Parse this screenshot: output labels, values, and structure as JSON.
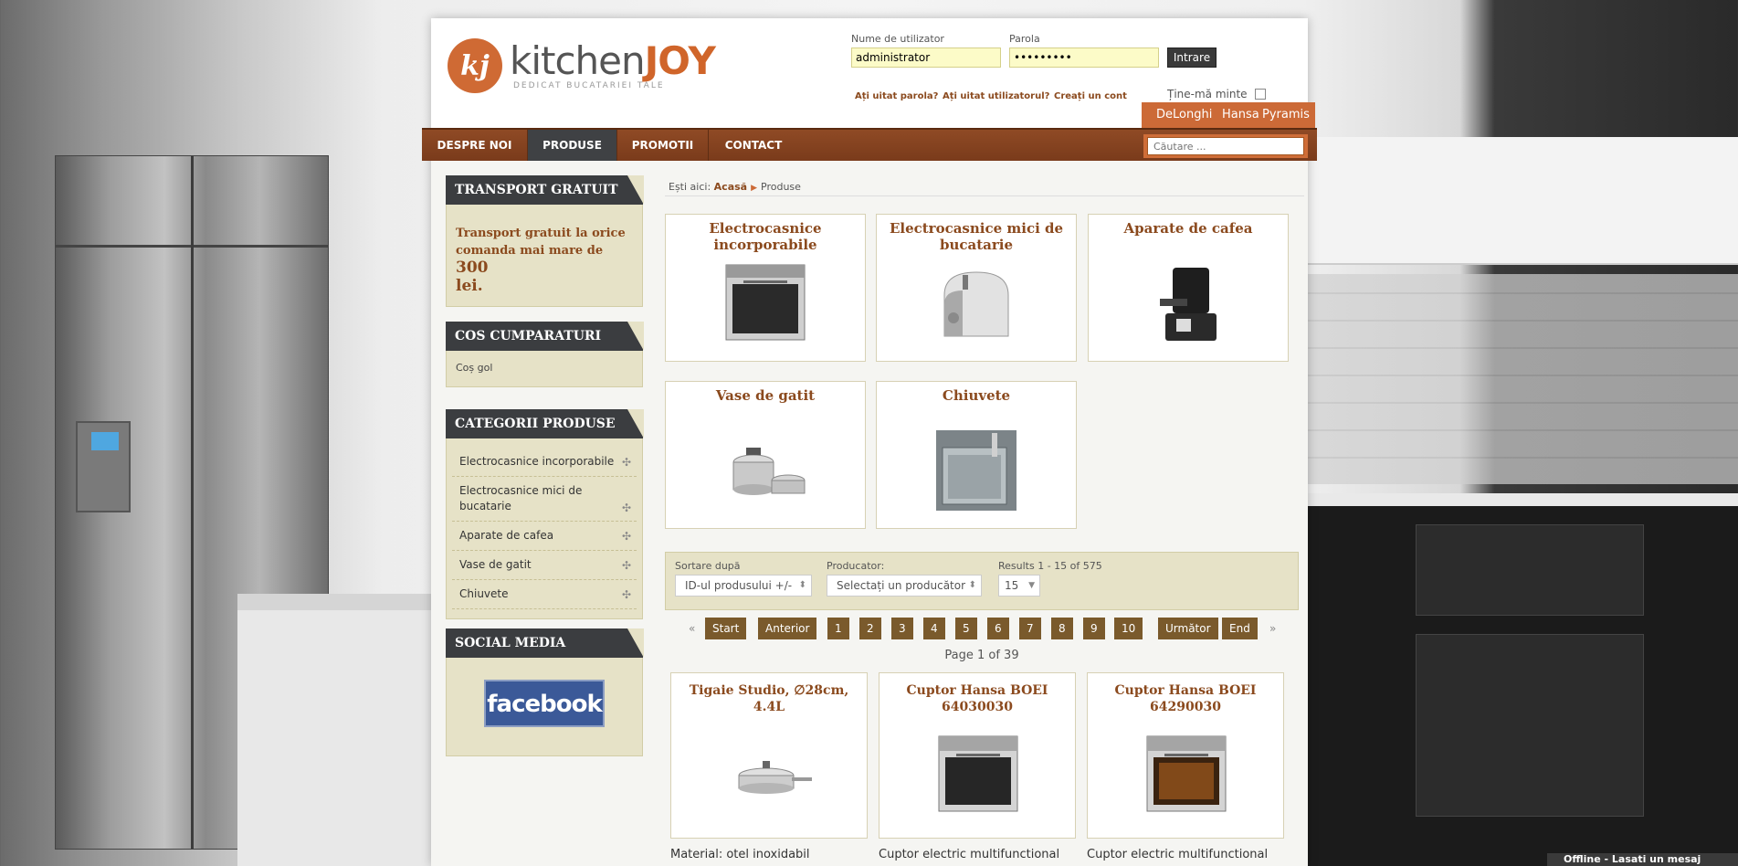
{
  "brand": {
    "logo_letters": "kj",
    "name_main": "kitchen",
    "name_accent": "JOY",
    "tagline": "DEDICAT BUCATARIEI TALE"
  },
  "login": {
    "username_label": "Nume de utilizator",
    "username_value": "administrator",
    "password_label": "Parola",
    "password_value": "•••••••••",
    "submit_label": "Intrare",
    "forgot_password": "Ați uitat parola?",
    "forgot_username": "Ați uitat utilizatorul?",
    "create_account": "Creați un cont",
    "remember_label": "Ține-mă minte"
  },
  "brands": [
    "DeLonghi",
    "Hansa",
    "Pyramis"
  ],
  "nav": [
    "DESPRE NOI",
    "PRODUSE",
    "PROMOTII",
    "CONTACT"
  ],
  "nav_active": "PRODUSE",
  "search": {
    "placeholder": "Căutare ..."
  },
  "sidebar": {
    "transport": {
      "title": "TRANSPORT GRATUIT",
      "text_a": "Transport gratuit la orice comanda mai mare de ",
      "amount": "300",
      "text_b": "lei."
    },
    "cart": {
      "title": "COS CUMPARATURI",
      "text": "Coș gol"
    },
    "categories": {
      "title": "CATEGORII PRODUSE",
      "items": [
        "Electrocasnice incorporabile",
        "Electrocasnice mici de bucatarie",
        "Aparate de cafea",
        "Vase de gatit",
        "Chiuvete"
      ]
    },
    "social": {
      "title": "SOCIAL MEDIA",
      "facebook": "facebook"
    }
  },
  "breadcrumb": {
    "prefix": "Ești aici:",
    "home": "Acasă",
    "current": "Produse"
  },
  "category_boxes": [
    "Electrocasnice incorporabile",
    "Electrocasnice mici de bucatarie",
    "Aparate de cafea",
    "Vase de gatit",
    "Chiuvete"
  ],
  "filters": {
    "sort_label": "Sortare după",
    "sort_value": "ID-ul produsului +/-",
    "producer_label": "Producator:",
    "producer_value": "Selectați un producător",
    "results_label": "Results 1 - 15 of 575",
    "per_page_value": "15"
  },
  "pagination": {
    "prev_arrow": "«",
    "start": "Start",
    "previous": "Anterior",
    "pages": [
      "1",
      "2",
      "3",
      "4",
      "5",
      "6",
      "7",
      "8",
      "9",
      "10"
    ],
    "next": "Următor",
    "end": "End",
    "next_arrow": "»",
    "info": "Page 1 of 39"
  },
  "products": [
    {
      "title": "Tigaie Studio, ∅28cm, 4.4L",
      "desc": "Material: otel inoxidabil"
    },
    {
      "title": "Cuptor Hansa BOEI 64030030",
      "desc": "Cuptor electric multifunctional"
    },
    {
      "title": "Cuptor Hansa BOEI 64290030",
      "desc": "Cuptor electric multifunctional"
    }
  ],
  "chat": {
    "label": "Offline - Lasati un mesaj"
  },
  "colors": {
    "accent": "#cc6a37",
    "nav": "#7a3b1b",
    "title_dark": "#3b3d40",
    "link": "#8b4a1e",
    "panel": "#e6e2c7"
  }
}
